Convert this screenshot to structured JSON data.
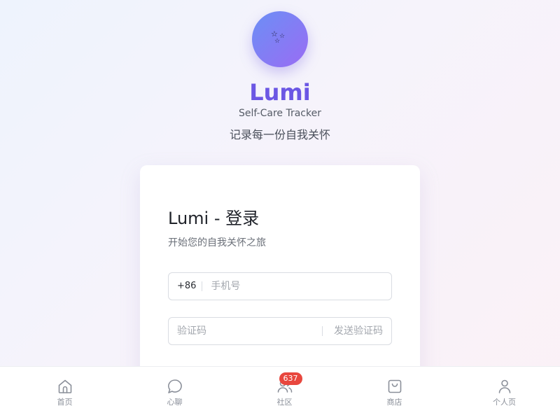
{
  "brand": {
    "name": "Lumi",
    "subtitle": "Self-Care Tracker",
    "tagline": "记录每一份自我关怀",
    "accent_color": "#6b57e4",
    "logo_icon": "stars-icon"
  },
  "login": {
    "title": "Lumi - 登录",
    "subtitle": "开始您的自我关怀之旅",
    "phone_prefix": "+86",
    "phone_placeholder": "手机号",
    "code_placeholder": "验证码",
    "send_code_label": "发送验证码"
  },
  "nav": {
    "items": [
      {
        "label": "首页",
        "icon": "home-icon"
      },
      {
        "label": "心聊",
        "icon": "chat-bubble-icon"
      },
      {
        "label": "社区",
        "icon": "community-icon",
        "badge": "637"
      },
      {
        "label": "商店",
        "icon": "shopping-bag-icon"
      },
      {
        "label": "个人页",
        "icon": "user-icon"
      }
    ],
    "badge_color": "#e8473e"
  }
}
